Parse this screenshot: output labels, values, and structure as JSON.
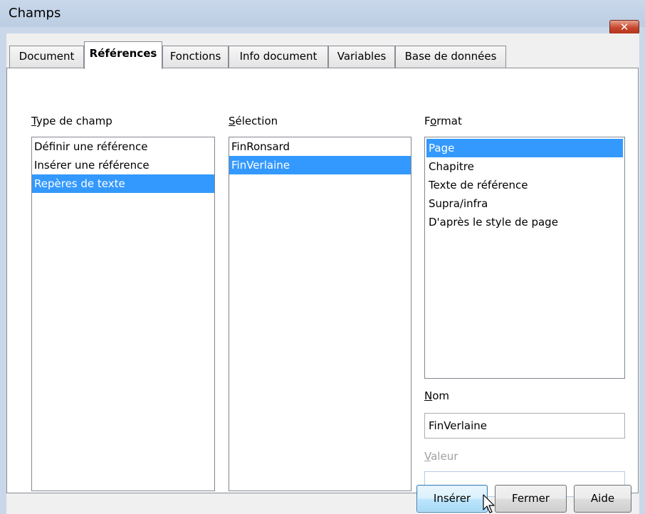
{
  "window": {
    "title": "Champs",
    "close_glyph": "✕"
  },
  "tabs": [
    {
      "label": "Document",
      "active": false
    },
    {
      "label": "Références",
      "active": true
    },
    {
      "label": "Fonctions",
      "active": false
    },
    {
      "label": "Info document",
      "active": false
    },
    {
      "label": "Variables",
      "active": false
    },
    {
      "label": "Base de données",
      "active": false
    }
  ],
  "type_de_champ": {
    "label_accel": "T",
    "label_rest": "ype de champ",
    "items": [
      "Définir une référence",
      "Insérer une référence",
      "Repères de texte"
    ],
    "selected_index": 2
  },
  "selection": {
    "label_accel": "S",
    "label_rest": "élection",
    "items": [
      "FinRonsard",
      "FinVerlaine"
    ],
    "selected_index": 1
  },
  "format": {
    "label_pre": "F",
    "label_accel": "o",
    "label_rest": "rmat",
    "items": [
      "Page",
      "Chapitre",
      "Texte de référence",
      "Supra/infra",
      "D'après le style de page"
    ],
    "selected_index": 0
  },
  "nom": {
    "label_accel": "N",
    "label_rest": "om",
    "value": "FinVerlaine"
  },
  "valeur": {
    "label_accel": "V",
    "label_rest": "aleur",
    "value": "",
    "enabled": false
  },
  "buttons": {
    "insert": "Insérer",
    "close": "Fermer",
    "help": "Aide"
  },
  "colors": {
    "selection": "#3399ff",
    "title_bar": "#c9d8ea",
    "close_button": "#c6482f"
  }
}
